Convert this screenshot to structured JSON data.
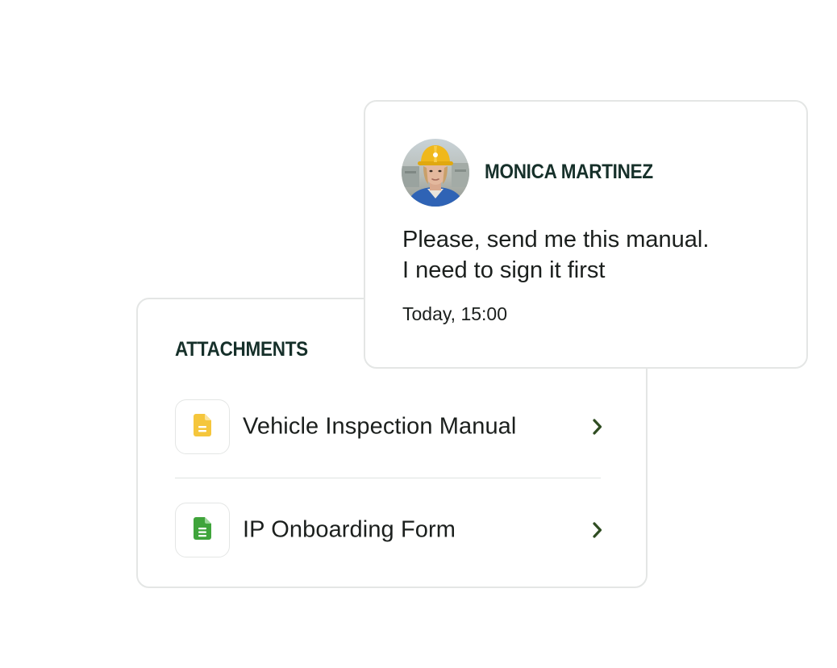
{
  "attachments": {
    "title": "ATTACHMENTS",
    "items": [
      {
        "name": "Vehicle Inspection Manual",
        "icon": "document-icon",
        "icon_color": "#f5c63c"
      },
      {
        "name": "IP Onboarding Form",
        "icon": "document-icon",
        "icon_color": "#3fa43b"
      }
    ],
    "chevron_color": "#2f4d22"
  },
  "message": {
    "sender": "MONICA MARTINEZ",
    "avatar": "avatar-photo",
    "lines": [
      "Please, send me this manual.",
      "I need to sign it first"
    ],
    "timestamp": "Today, 15:00"
  },
  "colors": {
    "heading": "#16302a",
    "text": "#1b1f1d",
    "border": "#e4e6e5"
  }
}
